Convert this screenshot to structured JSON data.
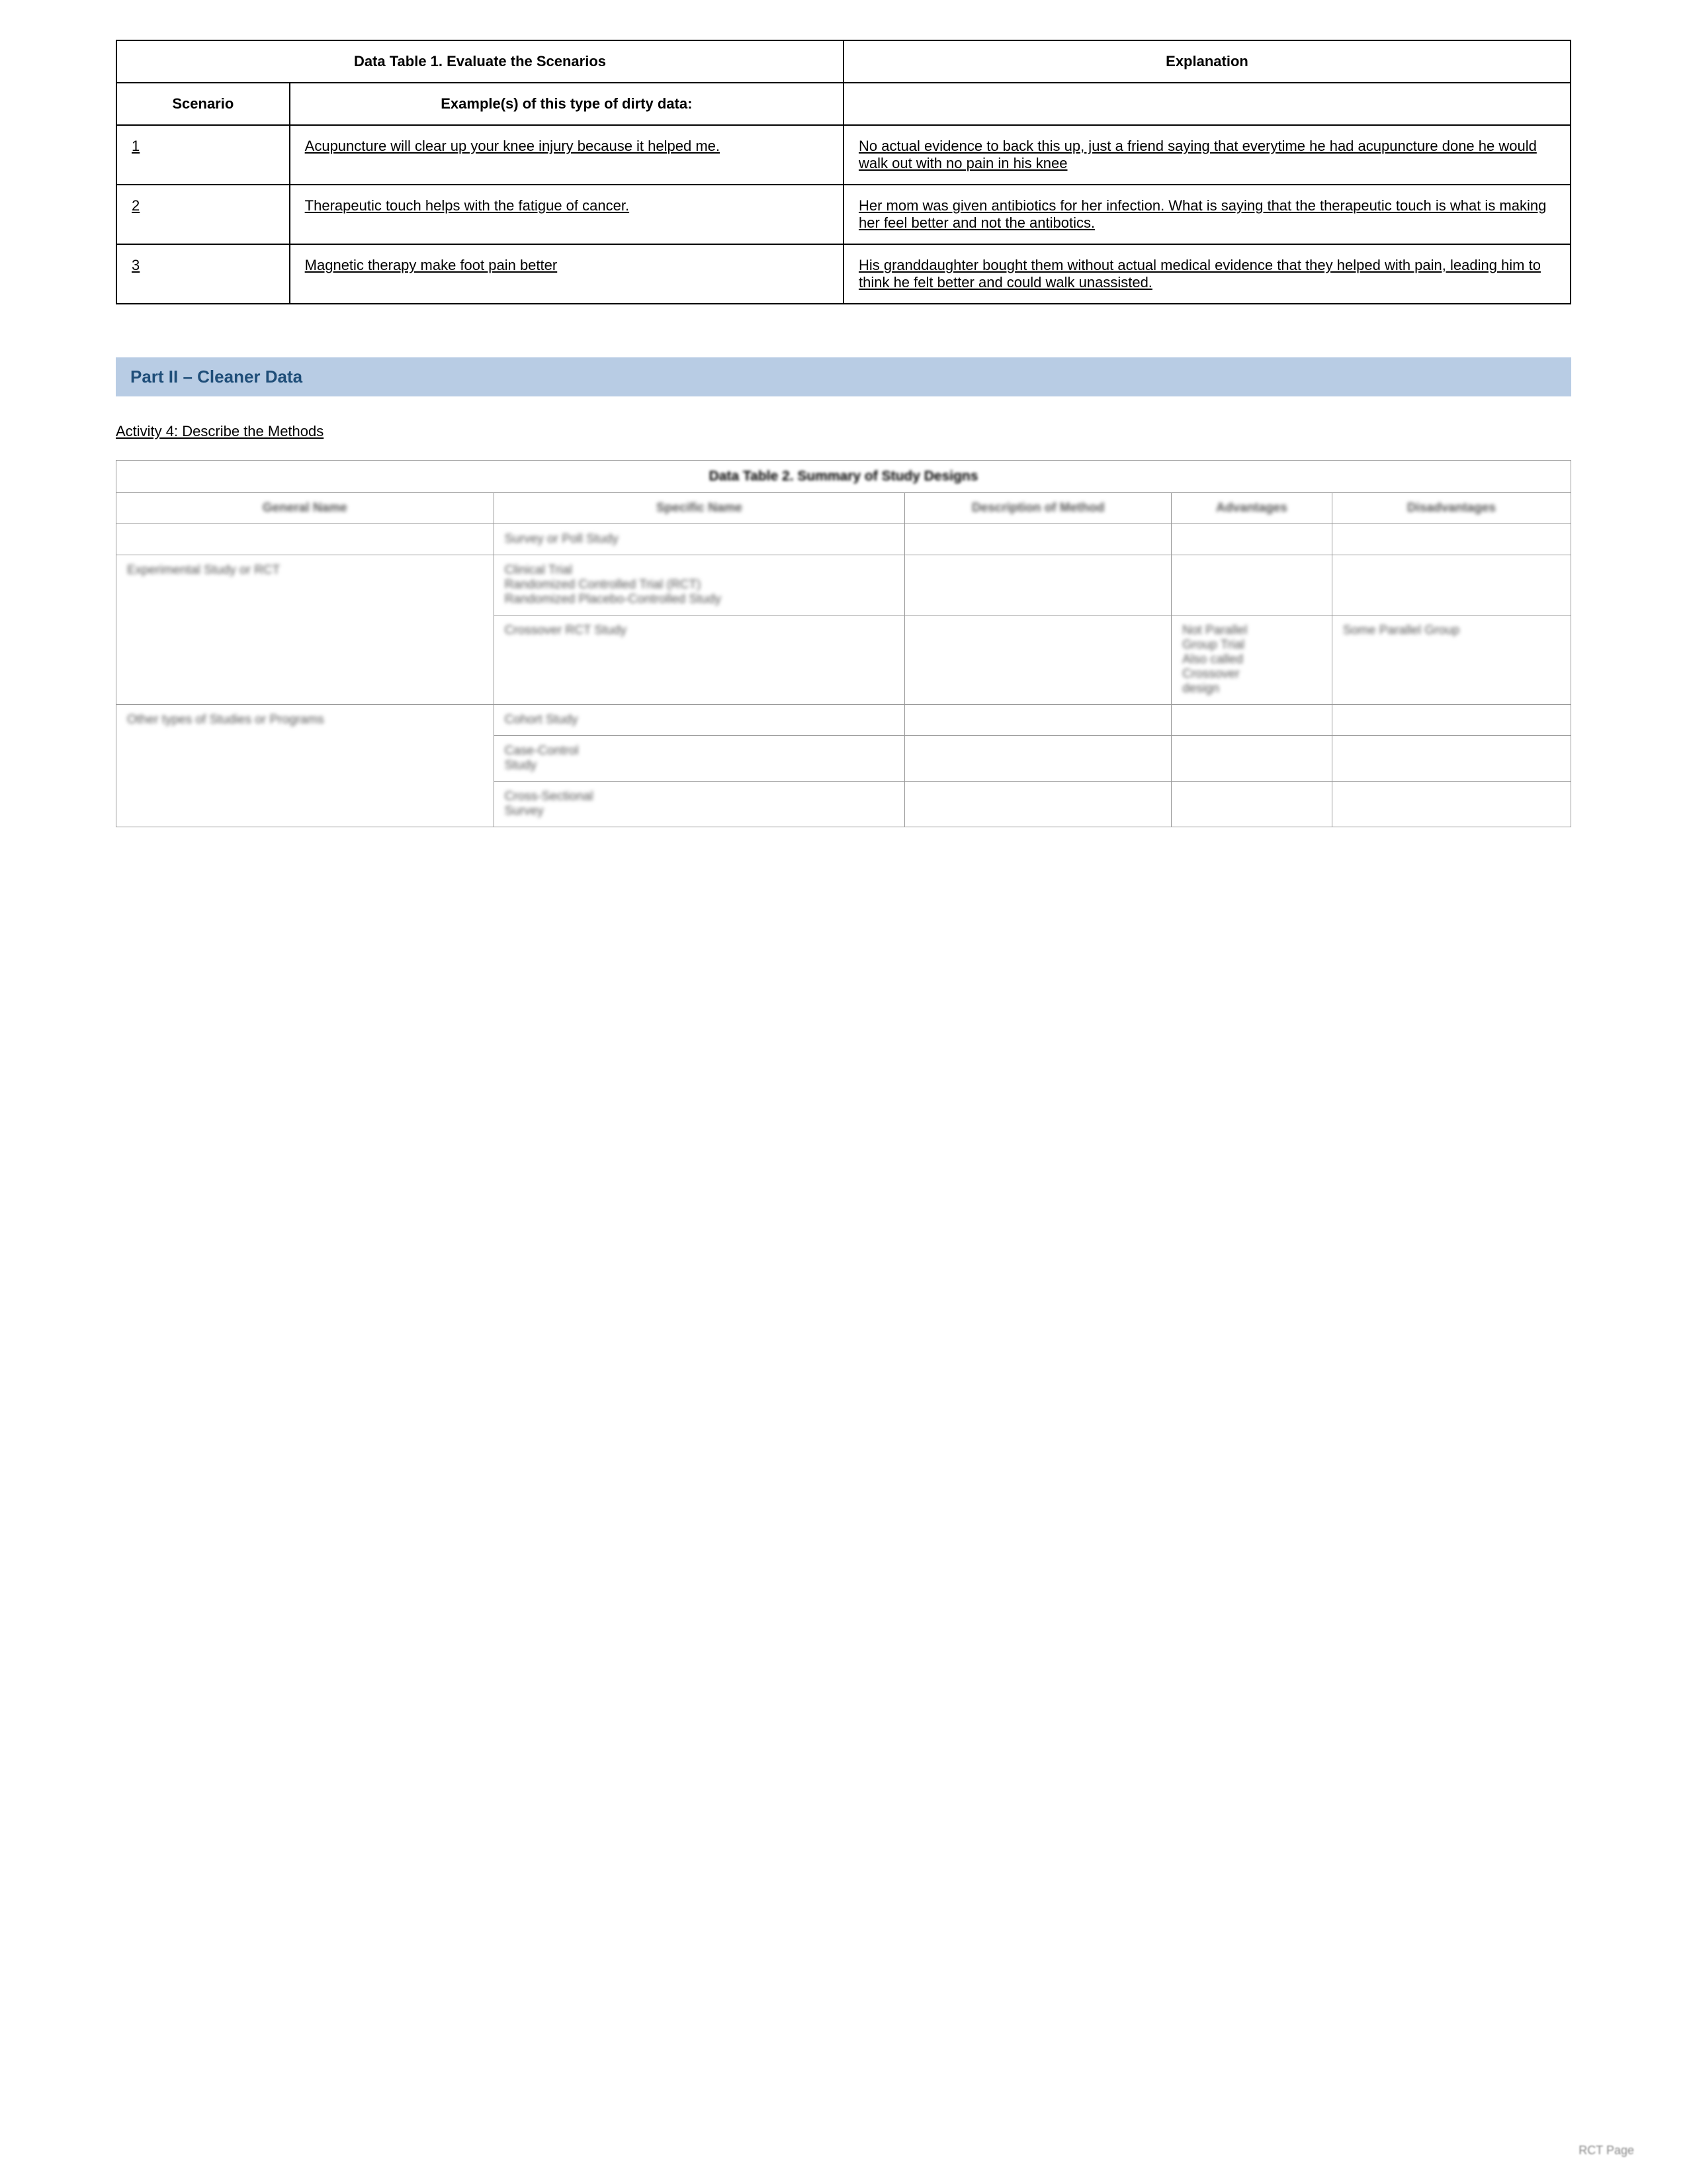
{
  "table1": {
    "title": "Data Table 1. Evaluate the Scenarios",
    "headers": {
      "scenario": "Scenario",
      "example": "Example(s) of this type of dirty data:",
      "explanation": "Explanation"
    },
    "rows": [
      {
        "scenario": "1",
        "example": "Acupuncture will clear up your knee injury because it helped me.",
        "explanation": "No actual evidence to back this up, just a friend saying that everytime he had acupuncture done he would walk out with no pain in his knee"
      },
      {
        "scenario": "2",
        "example": "Therapeutic touch helps with the fatigue of cancer.",
        "explanation": "Her mom was given antibiotics for her infection. What is saying that the therapeutic touch is what is making her feel better and not the antibotics."
      },
      {
        "scenario": "3",
        "example": "Magnetic therapy make foot pain better",
        "explanation": "His granddaughter bought them without actual medical evidence that they helped with pain, leading him to think he felt better and could walk unassisted."
      }
    ]
  },
  "partII": {
    "title": "Part II – Cleaner Data",
    "activity": "Activity 4: Describe the Methods ",
    "table2": {
      "title": "Data Table 2. Summary of Study Designs",
      "headers": [
        "General Name",
        "Specific Name",
        "Description of Method",
        "Advantages",
        "Disadvantages"
      ],
      "rows": [
        {
          "general": "",
          "specific": "Survey or Poll Study",
          "description": "",
          "advantages": "",
          "disadvantages": ""
        },
        {
          "general": "Experimental Study or RCT",
          "specific": "Clinical Trial Randomized Controlled Trial (RCT) Randomized Placebo-Controlled Study",
          "description": "",
          "advantages": "",
          "disadvantages": ""
        },
        {
          "general": "",
          "specific": "Crossover RCT Study",
          "description": "",
          "advantages": "Not Parallel Group Trial Also called Crossover design",
          "disadvantages": "Some Parallel Group"
        },
        {
          "general": "Other types of Studies or Programs",
          "specific": "Cohort Study",
          "description": "",
          "advantages": "",
          "disadvantages": ""
        },
        {
          "general": "",
          "specific": "Case-Control Study",
          "description": "",
          "advantages": "",
          "disadvantages": ""
        },
        {
          "general": "",
          "specific": "Cross-Sectional Survey",
          "description": "",
          "advantages": "",
          "disadvantages": ""
        }
      ]
    }
  },
  "pageNumber": "RCT Page"
}
